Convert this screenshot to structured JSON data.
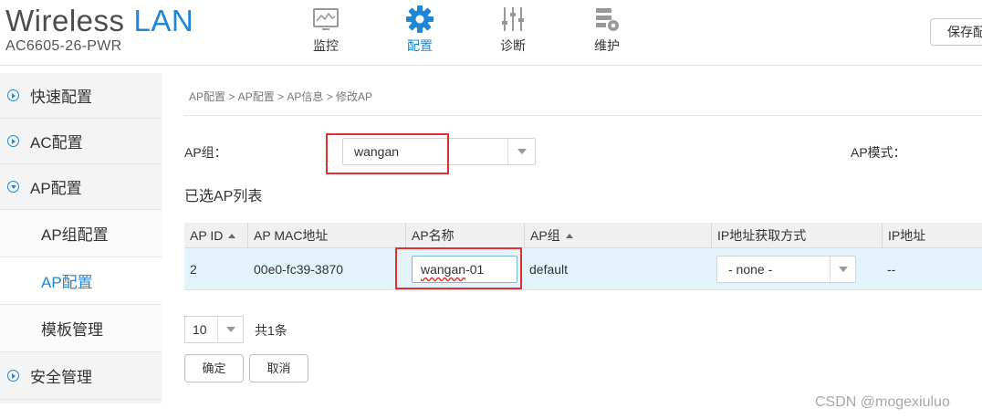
{
  "header": {
    "brand_main": "Wireless",
    "brand_accent": "LAN",
    "device_name": "AC6605-26-PWR",
    "nav": [
      {
        "label": "监控",
        "icon": "monitor-icon"
      },
      {
        "label": "配置",
        "icon": "gear-icon",
        "active": true
      },
      {
        "label": "诊断",
        "icon": "sliders-icon"
      },
      {
        "label": "维护",
        "icon": "maintenance-icon"
      }
    ],
    "save_label": "保存配"
  },
  "sidebar": {
    "items": [
      {
        "label": "快速配置"
      },
      {
        "label": "AC配置"
      },
      {
        "label": "AP配置"
      },
      {
        "label": "AP组配置"
      },
      {
        "label": "AP配置"
      },
      {
        "label": "模板管理"
      },
      {
        "label": "安全管理"
      }
    ]
  },
  "main": {
    "breadcrumb": "AP配置 > AP配置 > AP信息 > 修改AP",
    "ap_group_label": "AP组：",
    "ap_group_value": "wangan",
    "ap_mode_label": "AP模式：",
    "section_title": "已选AP列表",
    "table": {
      "headers": [
        "AP ID",
        "AP MAC地址",
        "AP名称",
        "AP组",
        "IP地址获取方式",
        "IP地址"
      ],
      "row": {
        "id": "2",
        "mac": "00e0-fc39-3870",
        "name_a": "wangan",
        "name_b": "-01",
        "group": "default",
        "ip_method": "- none -",
        "ip": "--"
      }
    },
    "page_size": "10",
    "total": "共1条",
    "confirm_label": "确定",
    "cancel_label": "取消"
  },
  "watermark": "CSDN @mogexiuluo",
  "colors": {
    "accent": "#1e88d6",
    "highlight": "#e0302d",
    "row_selected": "#e4f3fb"
  }
}
